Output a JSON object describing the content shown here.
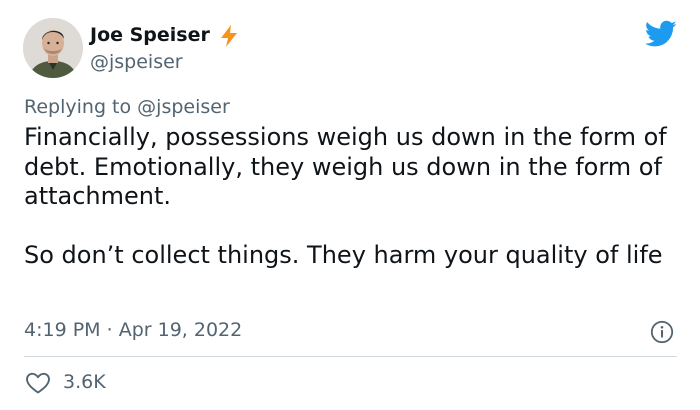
{
  "author": {
    "name": "Joe Speiser",
    "handle": "@jspeiser",
    "verified_icon": "lightning-bolt-icon"
  },
  "reply": {
    "prefix": "Replying to",
    "handle": "@jspeiser"
  },
  "tweet": {
    "paragraph_1": "Financially, possessions weigh us down in the form of debt. Emotionally, they weigh us down in the form of attachment.",
    "paragraph_2": "So don’t collect things. They harm your quality of life",
    "time": "4:19 PM",
    "separator": "·",
    "date": "Apr 19, 2022"
  },
  "engagement": {
    "likes": "3.6K"
  },
  "colors": {
    "text_primary": "#0f1419",
    "text_secondary": "#536471",
    "twitter_blue": "#1d9bf0",
    "bolt_orange": "#f7931a",
    "divider": "#cfd9de"
  },
  "icons": [
    "avatar",
    "lightning-bolt-icon",
    "twitter-bird-icon",
    "info-icon",
    "heart-icon"
  ]
}
